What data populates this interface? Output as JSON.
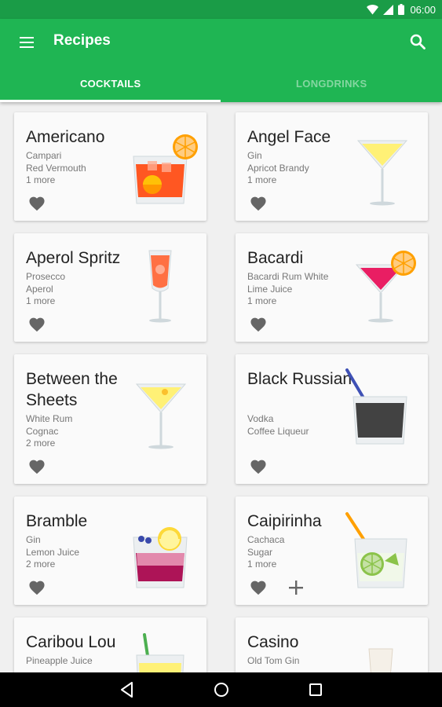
{
  "status": {
    "time": "06:00",
    "icons": [
      "wifi-icon",
      "signal-icon",
      "battery-icon"
    ]
  },
  "toolbar": {
    "title": "Recipes",
    "menu_icon": "menu-icon",
    "search_icon": "search-icon"
  },
  "tabs": [
    {
      "label": "COCKTAILS",
      "active": true
    },
    {
      "label": "LONGDRINKS",
      "active": false
    }
  ],
  "colors": {
    "primary": "#1fb553",
    "status_bar": "#1a9c47",
    "favorite_icon": "#666666"
  },
  "cocktails": [
    {
      "name": "Americano",
      "ingredients": [
        "Campari",
        "Red Vermouth"
      ],
      "more": "1 more",
      "glass": "tumbler-orange-icon"
    },
    {
      "name": "Angel Face",
      "ingredients": [
        "Gin",
        "Apricot Brandy"
      ],
      "more": "1 more",
      "glass": "martini-yellow-icon"
    },
    {
      "name": "Aperol Spritz",
      "ingredients": [
        "Prosecco",
        "Aperol"
      ],
      "more": "1 more",
      "glass": "flute-orange-icon"
    },
    {
      "name": "Bacardi",
      "ingredients": [
        "Bacardi Rum White",
        "Lime Juice"
      ],
      "more": "1 more",
      "glass": "martini-pink-icon"
    },
    {
      "name": "Between the Sheets",
      "ingredients": [
        "White Rum",
        "Cognac"
      ],
      "more": "2 more",
      "glass": "martini-lemon-icon"
    },
    {
      "name": "Black Russian",
      "ingredients": [
        "Vodka",
        "Coffee Liqueur"
      ],
      "more": "",
      "glass": "tumbler-black-icon"
    },
    {
      "name": "Bramble",
      "ingredients": [
        "Gin",
        "Lemon Juice"
      ],
      "more": "2 more",
      "glass": "tumbler-berry-icon"
    },
    {
      "name": "Caipirinha",
      "ingredients": [
        "Cachaca",
        "Sugar"
      ],
      "more": "1 more",
      "glass": "tumbler-lime-icon",
      "add_button": true
    },
    {
      "name": "Caribou Lou",
      "ingredients": [
        "Pineapple Juice"
      ],
      "more": "",
      "glass": "tumbler-yellow-icon"
    },
    {
      "name": "Casino",
      "ingredients": [
        "Old Tom Gin"
      ],
      "more": "",
      "glass": "glass-clear-icon"
    }
  ],
  "nav": {
    "back_icon": "back-icon",
    "home_icon": "home-icon",
    "recents_icon": "recents-icon"
  }
}
